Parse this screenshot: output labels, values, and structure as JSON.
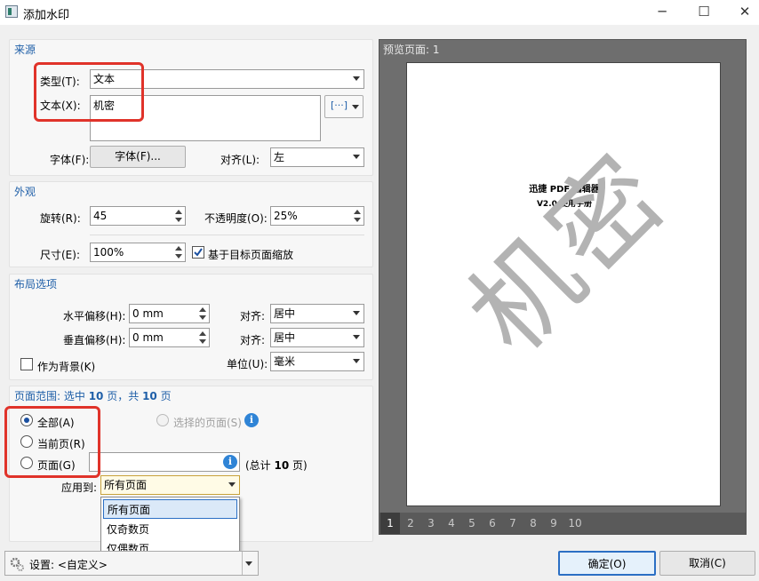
{
  "window": {
    "title": "添加水印",
    "minimize": "─",
    "maximize": "☐",
    "close": "✕"
  },
  "source": {
    "section_title": "来源",
    "type_label": "类型(T):",
    "type_value": "文本",
    "text_label": "文本(X):",
    "text_value": "机密",
    "insert_button": "[···]",
    "font_label": "字体(F):",
    "font_button": "字体(F)...",
    "align_label": "对齐(L):",
    "align_value": "左"
  },
  "appearance": {
    "section_title": "外观",
    "rotation_label": "旋转(R):",
    "rotation_value": "45",
    "opacity_label": "不透明度(O):",
    "opacity_value": "25%",
    "size_label": "尺寸(E):",
    "size_value": "100%",
    "scale_checkbox_label": "基于目标页面缩放",
    "scale_checked": true
  },
  "layout": {
    "section_title": "布局选项",
    "h_offset_label": "水平偏移(H):",
    "h_offset_value": "0 mm",
    "h_align_label": "对齐:",
    "h_align_value": "居中",
    "v_offset_label": "垂直偏移(H):",
    "v_offset_value": "0 mm",
    "v_align_label": "对齐:",
    "v_align_value": "居中",
    "background_label": "作为背景(K)",
    "unit_label": "单位(U):",
    "unit_value": "毫米"
  },
  "page_range": {
    "header_prefix": "页面范围: 选中",
    "selected_count": "10",
    "header_mid": "页，共",
    "total_count": "10",
    "header_suffix": "页",
    "all_label": "全部(A)",
    "selected_pages_label": "选择的页面(S)",
    "current_label": "当前页(R)",
    "pages_label": "页面(G)",
    "pages_value": "",
    "total_prefix": "(总计",
    "total_value": "10",
    "total_suffix": "页)",
    "apply_label": "应用到:",
    "apply_value": "所有页面",
    "apply_options": [
      "所有页面",
      "仅奇数页",
      "仅偶数页"
    ]
  },
  "preview": {
    "title": "预览页面: 1",
    "page_heading": "迅捷 PDF 编辑器",
    "page_subheading": "V2.0 使用手册",
    "watermark_text": "机密",
    "pages": [
      "1",
      "2",
      "3",
      "4",
      "5",
      "6",
      "7",
      "8",
      "9",
      "10"
    ],
    "active_page": "1"
  },
  "footer": {
    "settings_label": "设置: <自定义>",
    "ok_button": "确定(O)",
    "cancel_button": "取消(C)"
  },
  "colors": {
    "accent": "#1f5fa8",
    "highlight_border": "#e0332a",
    "watermark": "#b3b3b3",
    "ok_border": "#2b6fc4"
  }
}
